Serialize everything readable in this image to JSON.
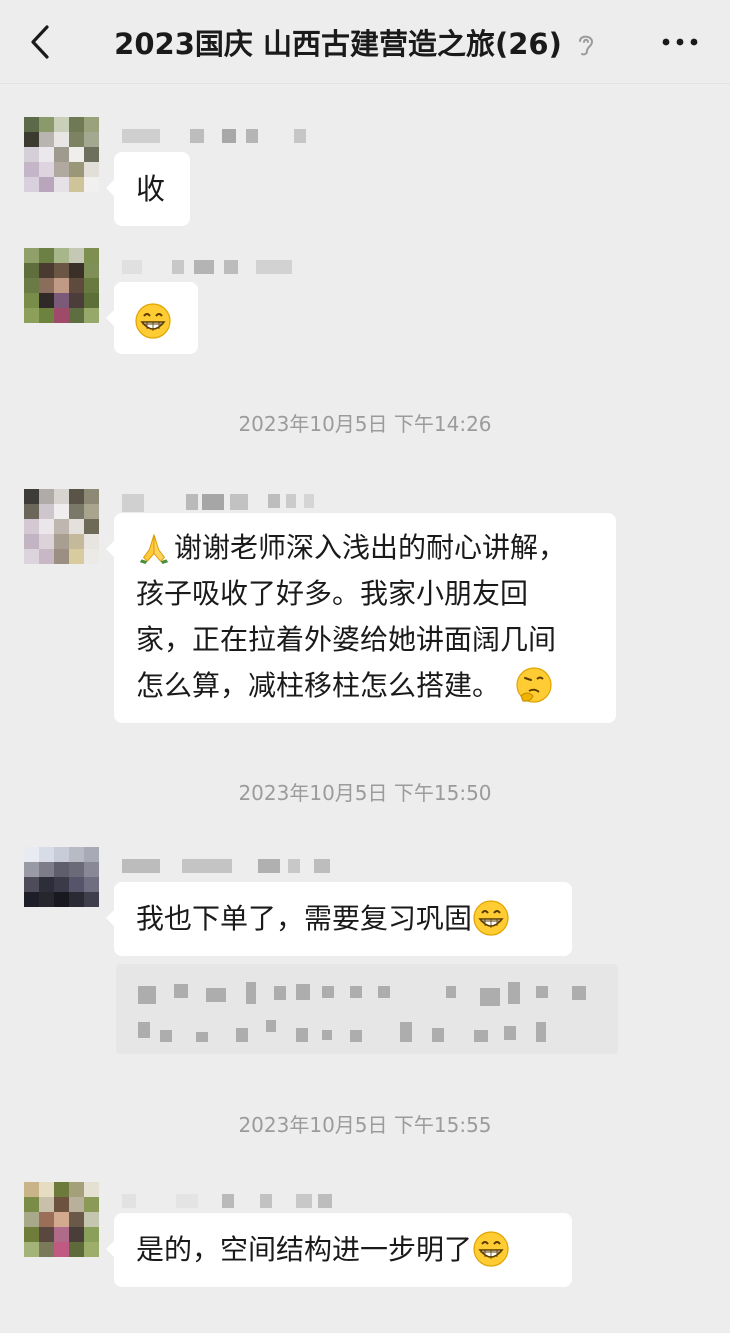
{
  "header": {
    "title": "2023国庆 山西古建营造之旅(26)",
    "back_icon": "chevron-left-icon",
    "ear_icon": "earpiece-icon",
    "more_icon": "more-dots-icon"
  },
  "messages": [
    {
      "text": "收"
    },
    {
      "emoji": "grin-emoji"
    },
    {
      "text": "谢谢老师深入浅出的耐心讲解，孩子吸收了好多。我家小朋友回家，正在拉着外婆给她讲面阔几间怎么算，减柱移柱怎么搭建。",
      "lines": [
        "谢谢老师深入浅出的耐心讲解，",
        "孩子吸收了好多。我家小朋友回",
        "家，正在拉着外婆给她讲面阔几间",
        "怎么算，减柱移柱怎么搭建。"
      ],
      "lead_emoji": "pray-emoji",
      "trail_emoji": "thinking-emoji"
    },
    {
      "text": "我也下单了，需要复习巩固",
      "trail_emoji": "grin-emoji"
    },
    {
      "text": "是的，空间结构进一步明了",
      "trail_emoji": "grin-emoji"
    }
  ],
  "timestamps": [
    "2023年10月5日  下午14:26",
    "2023年10月5日  下午15:50",
    "2023年10月5日  下午15:55"
  ],
  "colors": {
    "background": "#ededed",
    "bubble": "#ffffff",
    "timestamp": "#9b9b9b"
  }
}
